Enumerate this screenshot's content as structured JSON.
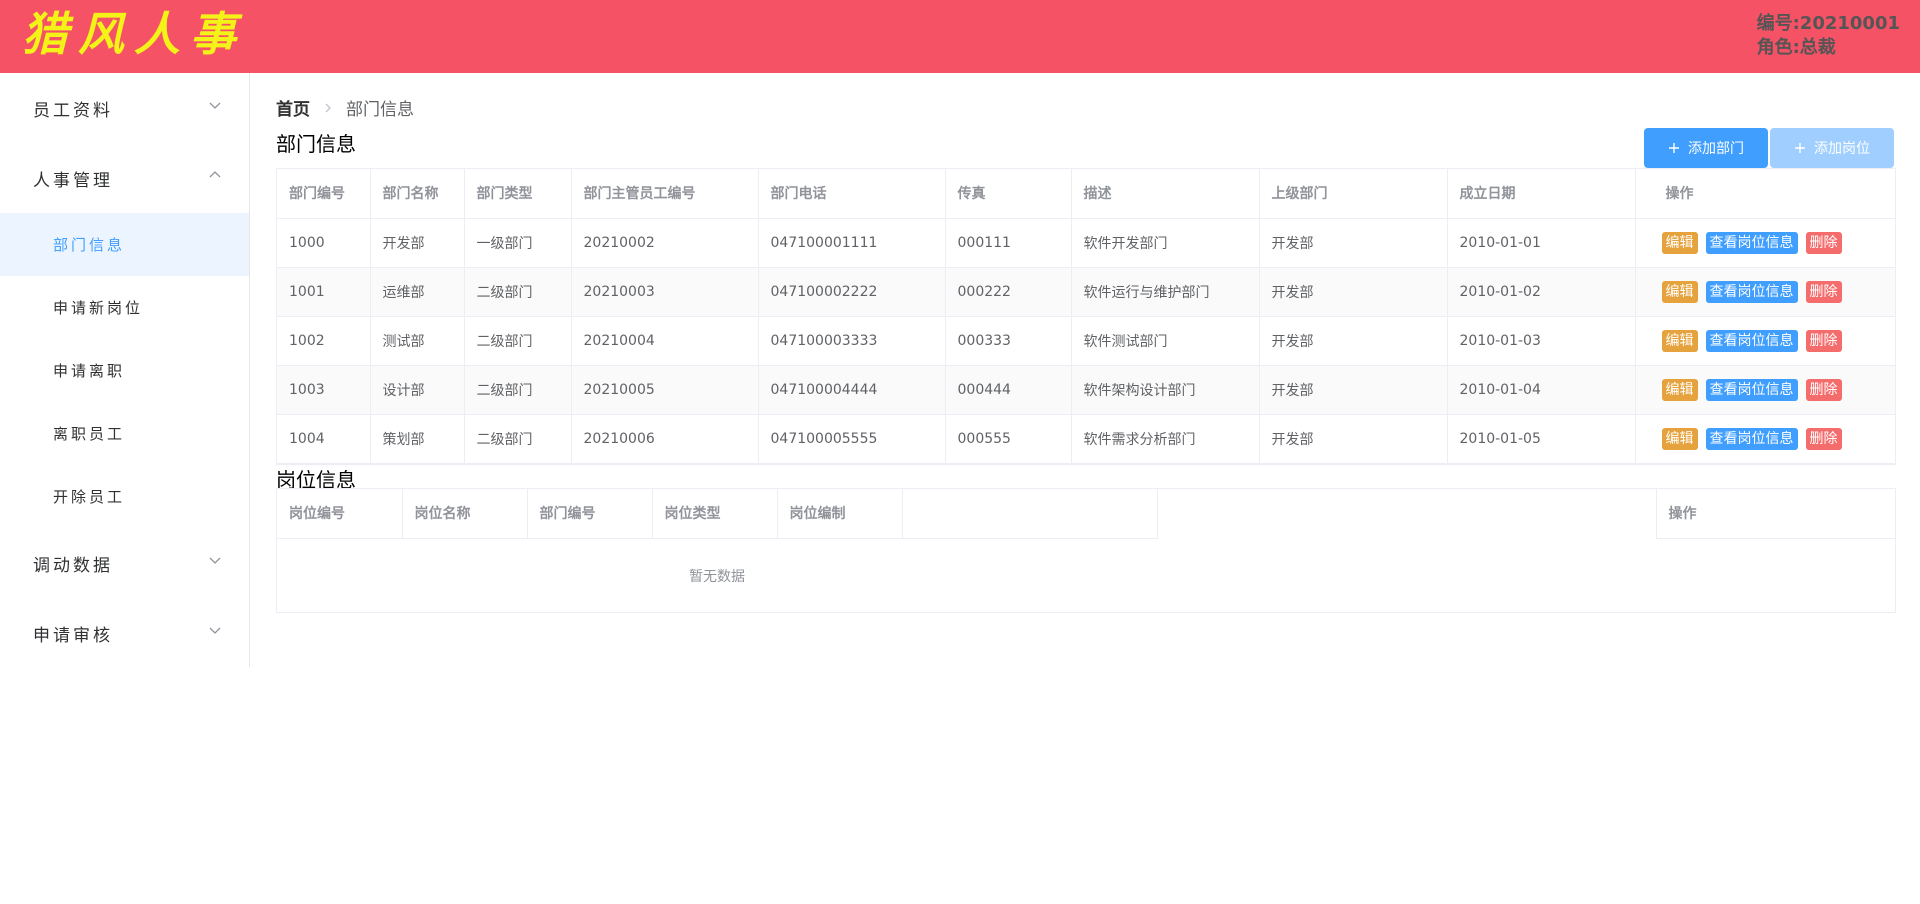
{
  "header": {
    "brand": "猎风人事",
    "user_id": "编号:20210001",
    "user_role": "角色:总裁"
  },
  "sidebar": {
    "groups": [
      {
        "label": "员工资料",
        "icon": "chevron-down-icon"
      },
      {
        "label": "人事管理",
        "icon": "chevron-up-icon",
        "items": [
          {
            "label": "部门信息",
            "active": true
          },
          {
            "label": "申请新岗位"
          },
          {
            "label": "申请离职"
          },
          {
            "label": "离职员工"
          },
          {
            "label": "开除员工"
          }
        ]
      },
      {
        "label": "调动数据",
        "icon": "chevron-down-icon"
      },
      {
        "label": "申请审核",
        "icon": "chevron-down-icon"
      }
    ]
  },
  "breadcrumb": {
    "home": "首页",
    "current": "部门信息"
  },
  "dept_section": {
    "title": "部门信息",
    "add_dept_label": "添加部门",
    "add_post_label": "添加岗位",
    "columns": [
      "部门编号",
      "部门名称",
      "部门类型",
      "部门主管员工编号",
      "部门电话",
      "传真",
      "描述",
      "上级部门",
      "成立日期",
      "操作"
    ],
    "rows": [
      [
        "1000",
        "开发部",
        "一级部门",
        "20210002",
        "047100001111",
        "000111",
        "软件开发部门",
        "开发部",
        "2010-01-01"
      ],
      [
        "1001",
        "运维部",
        "二级部门",
        "20210003",
        "047100002222",
        "000222",
        "软件运行与维护部门",
        "开发部",
        "2010-01-02"
      ],
      [
        "1002",
        "测试部",
        "二级部门",
        "20210004",
        "047100003333",
        "000333",
        "软件测试部门",
        "开发部",
        "2010-01-03"
      ],
      [
        "1003",
        "设计部",
        "二级部门",
        "20210005",
        "047100004444",
        "000444",
        "软件架构设计部门",
        "开发部",
        "2010-01-04"
      ],
      [
        "1004",
        "策划部",
        "二级部门",
        "20210006",
        "047100005555",
        "000555",
        "软件需求分析部门",
        "开发部",
        "2010-01-05"
      ]
    ],
    "actions": {
      "edit": "编辑",
      "view_posts": "查看岗位信息",
      "delete": "删除"
    }
  },
  "post_section": {
    "title": "岗位信息",
    "columns": [
      "岗位编号",
      "岗位名称",
      "部门编号",
      "岗位类型",
      "岗位编制",
      "",
      "操作"
    ],
    "empty_text": "暂无数据"
  },
  "colors": {
    "header_bg": "#f55266",
    "brand_text": "#f3f318",
    "primary": "#409eff",
    "warning": "#e6a23c",
    "danger": "#f56c6c",
    "active_menu_bg": "#ecf5ff"
  }
}
